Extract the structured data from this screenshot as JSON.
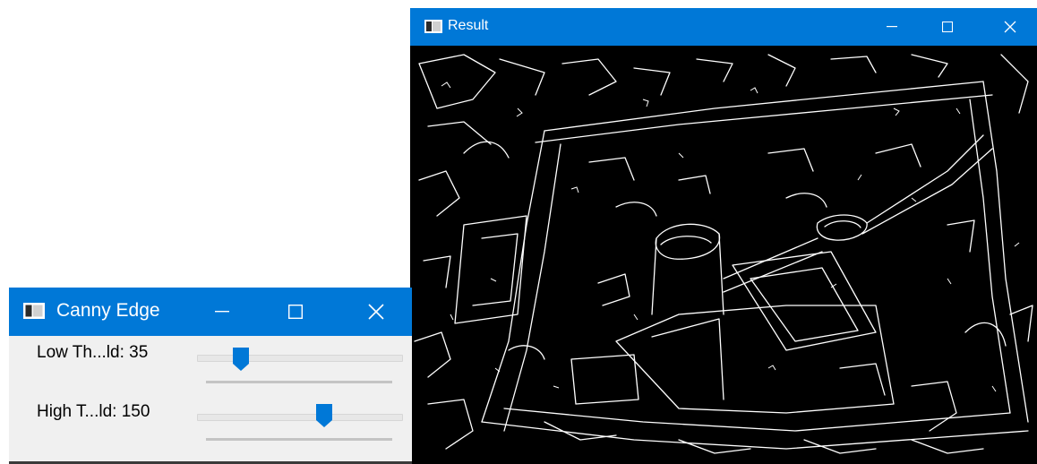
{
  "canny_window": {
    "title": "Canny Edge",
    "icon": "app-window-icon",
    "trackbars": [
      {
        "label": "Low Th...ld: 35",
        "value": 35,
        "max": 255
      },
      {
        "label": "High T...ld: 150",
        "value": 150,
        "max": 255
      }
    ]
  },
  "result_window": {
    "title": "Result",
    "icon": "app-window-icon",
    "image": "canny-edge-detection-output"
  },
  "colors": {
    "titlebar": "#0078d7",
    "slider_thumb": "#0078d7",
    "client_bg": "#f0f0f0",
    "image_bg": "#000000",
    "edges": "#ffffff"
  }
}
